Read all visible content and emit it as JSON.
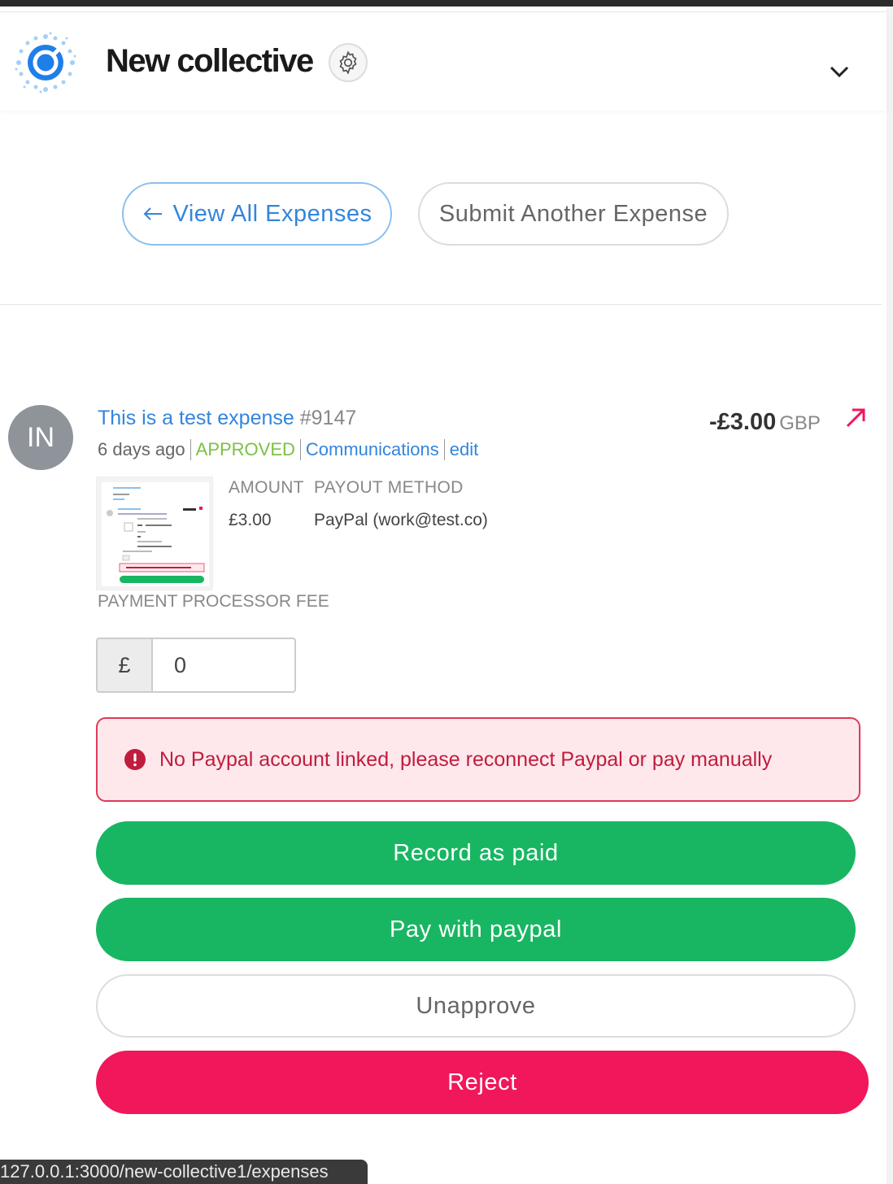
{
  "header": {
    "title": "New collective",
    "logo_icon": "open-collective-logo",
    "settings_icon": "gear-icon",
    "menu_icon": "chevron-down-icon"
  },
  "actions": {
    "view_all": "View All Expenses",
    "submit_another": "Submit Another Expense"
  },
  "expense": {
    "avatar_initials": "IN",
    "title": "This is a test expense",
    "id": "#9147",
    "age": "6 days ago",
    "status": "APPROVED",
    "communications": "Communications",
    "edit": "edit",
    "amount_total": "-£3.00",
    "currency": "GBP",
    "amount_label": "AMOUNT",
    "amount_value": "£3.00",
    "payout_label": "PAYOUT METHOD",
    "payout_value": "PayPal (work@test.co)",
    "fee_label": "PAYMENT PROCESSOR FEE",
    "fee_prefix": "£",
    "fee_value": "0"
  },
  "alert": {
    "text": "No Paypal account linked, please reconnect Paypal or pay manually"
  },
  "buttons": {
    "record_paid": "Record as paid",
    "pay_paypal": "Pay with paypal",
    "unapprove": "Unapprove",
    "reject": "Reject"
  },
  "statusbar": {
    "url": "127.0.0.1:3000/new-collective1/expenses"
  },
  "colors": {
    "accent_blue": "#3385dd",
    "approved_green": "#7ac143",
    "button_green": "#18b662",
    "reject_red": "#f0175a",
    "alert_red": "#c01c3c"
  }
}
